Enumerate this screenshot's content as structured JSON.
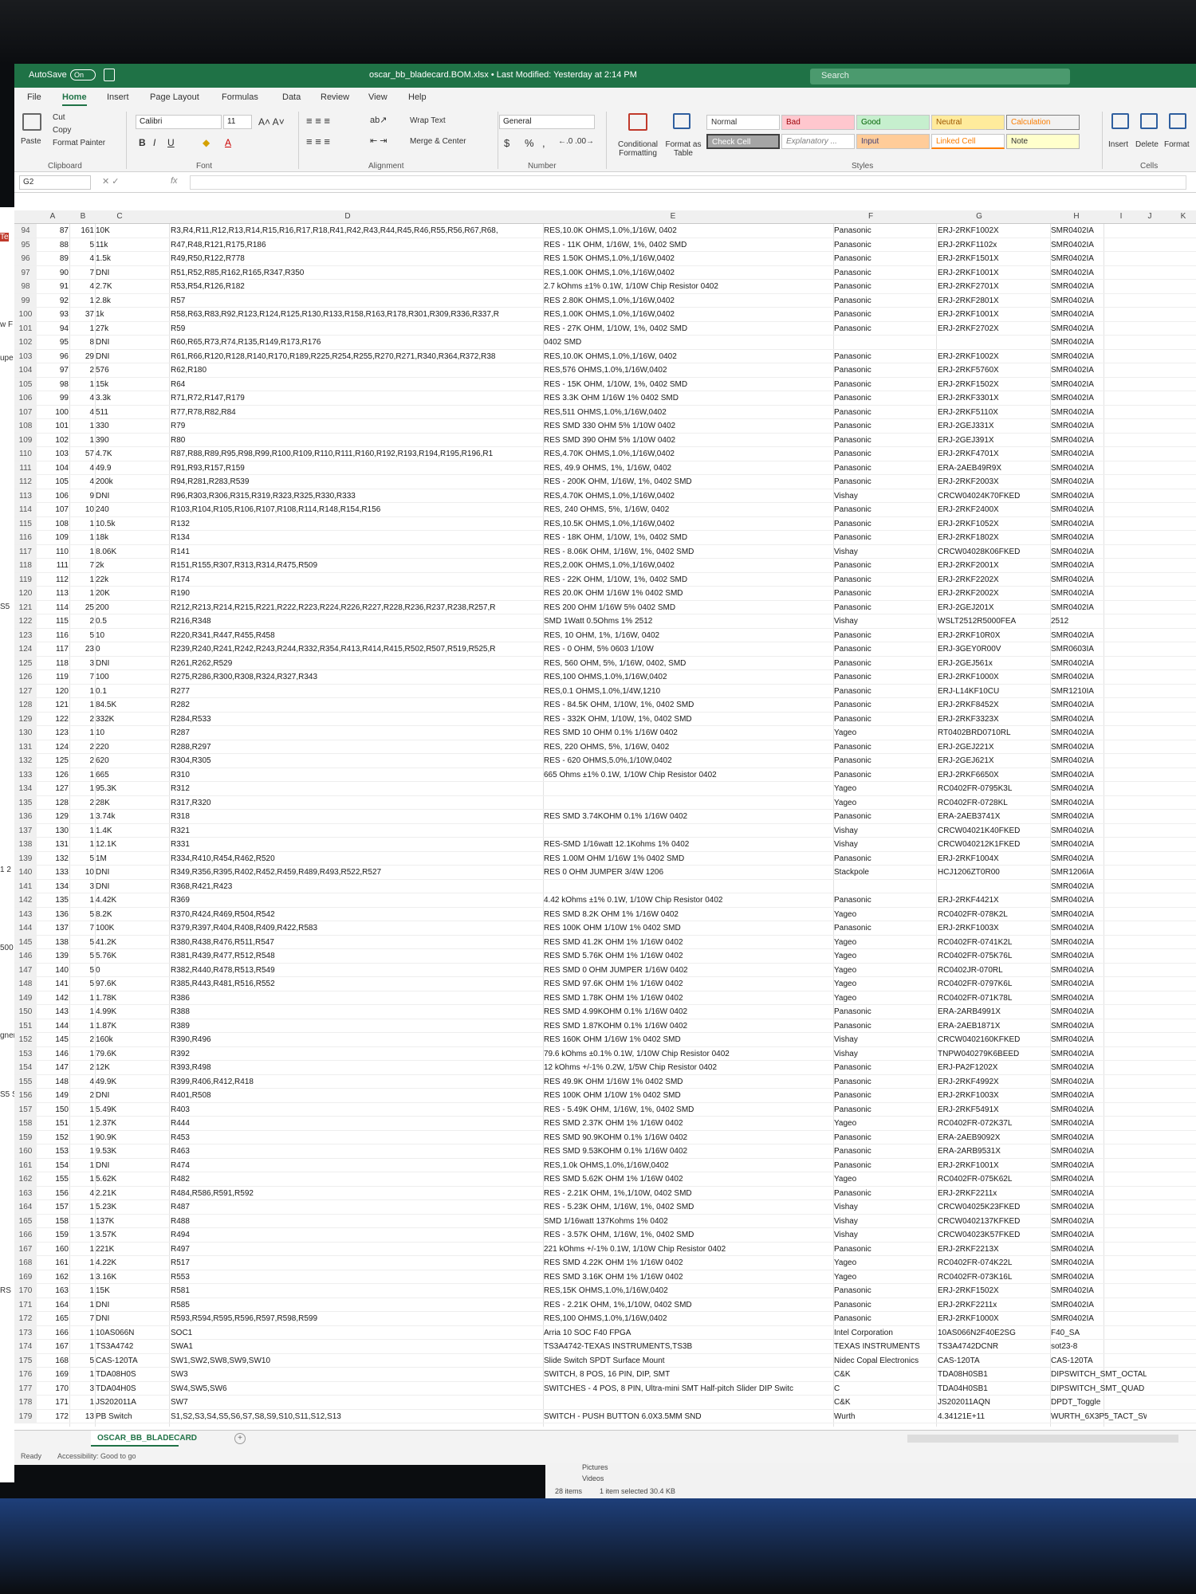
{
  "app": {
    "autosave_label": "AutoSave",
    "autosave_state": "On",
    "file_title": "oscar_bb_bladecard.BOM.xlsx • Last Modified: Yesterday at 2:14 PM",
    "search_placeholder": "Search"
  },
  "tabs": [
    "File",
    "Home",
    "Insert",
    "Page Layout",
    "Formulas",
    "Data",
    "Review",
    "View",
    "Help"
  ],
  "ribbon": {
    "clipboard": {
      "label": "Clipboard",
      "paste": "Paste",
      "cut": "Cut",
      "copy": "Copy",
      "format_painter": "Format Painter"
    },
    "font": {
      "label": "Font",
      "name": "Calibri",
      "size": "11"
    },
    "alignment": {
      "label": "Alignment",
      "wrap": "Wrap Text",
      "merge": "Merge & Center"
    },
    "number": {
      "label": "Number",
      "format": "General",
      "currency": "$",
      "percent": "%",
      "comma": ","
    },
    "styles": {
      "label": "Styles",
      "conditional": "Conditional Formatting",
      "format_table": "Format as Table",
      "items": [
        [
          "Normal",
          "Bad",
          "Good",
          "Neutral",
          "Calculation"
        ],
        [
          "Check Cell",
          "Explanatory ...",
          "Input",
          "Linked Cell",
          "Note"
        ]
      ]
    },
    "cells": {
      "label": "Cells",
      "insert": "Insert",
      "delete": "Delete",
      "format": "Format"
    }
  },
  "name_box": "G2",
  "fx": "fx",
  "columns": [
    "A",
    "B",
    "C",
    "D",
    "E",
    "F",
    "G",
    "H",
    "I",
    "J",
    "K"
  ],
  "rows": [
    [
      "94",
      "87",
      "161",
      "10K",
      "R3,R4,R11,R12,R13,R14,R15,R16,R17,R18,R41,R42,R43,R44,R45,R46,R55,R56,R67,R68,",
      "RES,10.0K OHMS,1.0%,1/16W, 0402",
      "Panasonic",
      "ERJ-2RKF1002X",
      "SMR0402IA"
    ],
    [
      "95",
      "88",
      "5",
      "11k",
      "R47,R48,R121,R175,R186",
      "RES - 11K OHM, 1/16W, 1%, 0402 SMD",
      "Panasonic",
      "ERJ-2RKF1102x",
      "SMR0402IA"
    ],
    [
      "96",
      "89",
      "4",
      "1.5k",
      "R49,R50,R122,R778",
      "RES 1.50K OHMS,1.0%,1/16W,0402",
      "Panasonic",
      "ERJ-2RKF1501X",
      "SMR0402IA"
    ],
    [
      "97",
      "90",
      "7",
      "DNI",
      "R51,R52,R85,R162,R165,R347,R350",
      "RES,1.00K OHMS,1.0%,1/16W,0402",
      "Panasonic",
      "ERJ-2RKF1001X",
      "SMR0402IA"
    ],
    [
      "98",
      "91",
      "4",
      "2.7K",
      "R53,R54,R126,R182",
      "2.7 kOhms ±1% 0.1W, 1/10W Chip Resistor 0402",
      "Panasonic",
      "ERJ-2RKF2701X",
      "SMR0402IA"
    ],
    [
      "99",
      "92",
      "1",
      "2.8k",
      "R57",
      "RES 2.80K OHMS,1.0%,1/16W,0402",
      "Panasonic",
      "ERJ-2RKF2801X",
      "SMR0402IA"
    ],
    [
      "100",
      "93",
      "37",
      "1k",
      "R58,R63,R83,R92,R123,R124,R125,R130,R133,R158,R163,R178,R301,R309,R336,R337,R",
      "RES,1.00K OHMS,1.0%,1/16W,0402",
      "Panasonic",
      "ERJ-2RKF1001X",
      "SMR0402IA"
    ],
    [
      "101",
      "94",
      "1",
      "27k",
      "R59",
      "RES - 27K OHM, 1/10W, 1%, 0402 SMD",
      "Panasonic",
      "ERJ-2RKF2702X",
      "SMR0402IA"
    ],
    [
      "102",
      "95",
      "8",
      "DNI",
      "R60,R65,R73,R74,R135,R149,R173,R176",
      "0402 SMD",
      "",
      "",
      "SMR0402IA"
    ],
    [
      "103",
      "96",
      "29",
      "DNI",
      "R61,R66,R120,R128,R140,R170,R189,R225,R254,R255,R270,R271,R340,R364,R372,R38",
      "RES,10.0K OHMS,1.0%,1/16W, 0402",
      "Panasonic",
      "ERJ-2RKF1002X",
      "SMR0402IA"
    ],
    [
      "104",
      "97",
      "2",
      "576",
      "R62,R180",
      "RES,576 OHMS,1.0%,1/16W,0402",
      "Panasonic",
      "ERJ-2RKF5760X",
      "SMR0402IA"
    ],
    [
      "105",
      "98",
      "1",
      "15k",
      "R64",
      "RES - 15K OHM, 1/10W, 1%, 0402 SMD",
      "Panasonic",
      "ERJ-2RKF1502X",
      "SMR0402IA"
    ],
    [
      "106",
      "99",
      "4",
      "3.3k",
      "R71,R72,R147,R179",
      "RES 3.3K OHM 1/16W 1% 0402 SMD",
      "Panasonic",
      "ERJ-2RKF3301X",
      "SMR0402IA"
    ],
    [
      "107",
      "100",
      "4",
      "511",
      "R77,R78,R82,R84",
      "RES,511 OHMS,1.0%,1/16W,0402",
      "Panasonic",
      "ERJ-2RKF5110X",
      "SMR0402IA"
    ],
    [
      "108",
      "101",
      "1",
      "330",
      "R79",
      "RES SMD 330 OHM 5% 1/10W 0402",
      "Panasonic",
      "ERJ-2GEJ331X",
      "SMR0402IA"
    ],
    [
      "109",
      "102",
      "1",
      "390",
      "R80",
      "RES SMD 390 OHM 5% 1/10W 0402",
      "Panasonic",
      "ERJ-2GEJ391X",
      "SMR0402IA"
    ],
    [
      "110",
      "103",
      "57",
      "4.7K",
      "R87,R88,R89,R95,R98,R99,R100,R109,R110,R111,R160,R192,R193,R194,R195,R196,R1",
      "RES,4.70K OHMS,1.0%,1/16W,0402",
      "Panasonic",
      "ERJ-2RKF4701X",
      "SMR0402IA"
    ],
    [
      "111",
      "104",
      "4",
      "49.9",
      "R91,R93,R157,R159",
      "RES, 49.9 OHMS, 1%, 1/16W, 0402",
      "Panasonic",
      "ERA-2AEB49R9X",
      "SMR0402IA"
    ],
    [
      "112",
      "105",
      "4",
      "200k",
      "R94,R281,R283,R539",
      "RES - 200K OHM, 1/16W, 1%, 0402 SMD",
      "Panasonic",
      "ERJ-2RKF2003X",
      "SMR0402IA"
    ],
    [
      "113",
      "106",
      "9",
      "DNI",
      "R96,R303,R306,R315,R319,R323,R325,R330,R333",
      "RES,4.70K OHMS,1.0%,1/16W,0402",
      "Vishay",
      "CRCW04024K70FKED",
      "SMR0402IA"
    ],
    [
      "114",
      "107",
      "10",
      "240",
      "R103,R104,R105,R106,R107,R108,R114,R148,R154,R156",
      "RES, 240 OHMS, 5%, 1/16W, 0402",
      "Panasonic",
      "ERJ-2RKF2400X",
      "SMR0402IA"
    ],
    [
      "115",
      "108",
      "1",
      "10.5k",
      "R132",
      "RES,10.5K OHMS,1.0%,1/16W,0402",
      "Panasonic",
      "ERJ-2RKF1052X",
      "SMR0402IA"
    ],
    [
      "116",
      "109",
      "1",
      "18k",
      "R134",
      "RES - 18K OHM, 1/10W, 1%, 0402 SMD",
      "Panasonic",
      "ERJ-2RKF1802X",
      "SMR0402IA"
    ],
    [
      "117",
      "110",
      "1",
      "8.06K",
      "R141",
      "RES - 8.06K OHM, 1/16W, 1%, 0402 SMD",
      "Vishay",
      "CRCW04028K06FKED",
      "SMR0402IA"
    ],
    [
      "118",
      "111",
      "7",
      "2k",
      "R151,R155,R307,R313,R314,R475,R509",
      "RES,2.00K OHMS,1.0%,1/16W,0402",
      "Panasonic",
      "ERJ-2RKF2001X",
      "SMR0402IA"
    ],
    [
      "119",
      "112",
      "1",
      "22k",
      "R174",
      "RES - 22K OHM, 1/10W, 1%, 0402 SMD",
      "Panasonic",
      "ERJ-2RKF2202X",
      "SMR0402IA"
    ],
    [
      "120",
      "113",
      "1",
      "20K",
      "R190",
      "RES 20.0K OHM 1/16W 1% 0402 SMD",
      "Panasonic",
      "ERJ-2RKF2002X",
      "SMR0402IA"
    ],
    [
      "121",
      "114",
      "25",
      "200",
      "R212,R213,R214,R215,R221,R222,R223,R224,R226,R227,R228,R236,R237,R238,R257,R",
      "RES 200 OHM 1/16W 5% 0402 SMD",
      "Panasonic",
      "ERJ-2GEJ201X",
      "SMR0402IA"
    ],
    [
      "122",
      "115",
      "2",
      "0.5",
      "R216,R348",
      "SMD 1Watt 0.5Ohms 1% 2512",
      "Vishay",
      "WSLT2512R5000FEA",
      "2512"
    ],
    [
      "123",
      "116",
      "5",
      "10",
      "R220,R341,R447,R455,R458",
      "RES, 10 OHM, 1%, 1/16W, 0402",
      "Panasonic",
      "ERJ-2RKF10R0X",
      "SMR0402IA"
    ],
    [
      "124",
      "117",
      "23",
      "0",
      "R239,R240,R241,R242,R243,R244,R332,R354,R413,R414,R415,R502,R507,R519,R525,R",
      "RES - 0 OHM, 5% 0603 1/10W",
      "Panasonic",
      "ERJ-3GEY0R00V",
      "SMR0603IA"
    ],
    [
      "125",
      "118",
      "3",
      "DNI",
      "R261,R262,R529",
      "RES, 560 OHM, 5%, 1/16W, 0402, SMD",
      "Panasonic",
      "ERJ-2GEJ561x",
      "SMR0402IA"
    ],
    [
      "126",
      "119",
      "7",
      "100",
      "R275,R286,R300,R308,R324,R327,R343",
      "RES,100 OHMS,1.0%,1/16W,0402",
      "Panasonic",
      "ERJ-2RKF1000X",
      "SMR0402IA"
    ],
    [
      "127",
      "120",
      "1",
      "0.1",
      "R277",
      "RES,0.1 OHMS,1.0%,1/4W,1210",
      "Panasonic",
      "ERJ-L14KF10CU",
      "SMR1210IA"
    ],
    [
      "128",
      "121",
      "1",
      "84.5K",
      "R282",
      "RES - 84.5K OHM, 1/10W, 1%, 0402 SMD",
      "Panasonic",
      "ERJ-2RKF8452X",
      "SMR0402IA"
    ],
    [
      "129",
      "122",
      "2",
      "332K",
      "R284,R533",
      "RES - 332K OHM, 1/10W, 1%, 0402 SMD",
      "Panasonic",
      "ERJ-2RKF3323X",
      "SMR0402IA"
    ],
    [
      "130",
      "123",
      "1",
      "10",
      "R287",
      "RES SMD 10 OHM 0.1% 1/16W 0402",
      "Yageo",
      "RT0402BRD0710RL",
      "SMR0402IA"
    ],
    [
      "131",
      "124",
      "2",
      "220",
      "R288,R297",
      "RES, 220 OHMS, 5%, 1/16W, 0402",
      "Panasonic",
      "ERJ-2GEJ221X",
      "SMR0402IA"
    ],
    [
      "132",
      "125",
      "2",
      "620",
      "R304,R305",
      "RES - 620 OHMS,5.0%,1/10W,0402",
      "Panasonic",
      "ERJ-2GEJ621X",
      "SMR0402IA"
    ],
    [
      "133",
      "126",
      "1",
      "665",
      "R310",
      "665 Ohms ±1% 0.1W, 1/10W Chip Resistor 0402",
      "Panasonic",
      "ERJ-2RKF6650X",
      "SMR0402IA"
    ],
    [
      "134",
      "127",
      "1",
      "95.3K",
      "R312",
      "",
      "Yageo",
      "RC0402FR-0795K3L",
      "SMR0402IA"
    ],
    [
      "135",
      "128",
      "2",
      "28K",
      "R317,R320",
      "",
      "Yageo",
      "RC0402FR-0728KL",
      "SMR0402IA"
    ],
    [
      "136",
      "129",
      "1",
      "3.74k",
      "R318",
      "RES SMD 3.74KOHM 0.1% 1/16W 0402",
      "Panasonic",
      "ERA-2AEB3741X",
      "SMR0402IA"
    ],
    [
      "137",
      "130",
      "1",
      "1.4K",
      "R321",
      "",
      "Vishay",
      "CRCW04021K40FKED",
      "SMR0402IA"
    ],
    [
      "138",
      "131",
      "1",
      "12.1K",
      "R331",
      "RES-SMD 1/16watt 12.1Kohms 1% 0402",
      "Vishay",
      "CRCW040212K1FKED",
      "SMR0402IA"
    ],
    [
      "139",
      "132",
      "5",
      "1M",
      "R334,R410,R454,R462,R520",
      "RES 1.00M OHM 1/16W 1% 0402 SMD",
      "Panasonic",
      "ERJ-2RKF1004X",
      "SMR0402IA"
    ],
    [
      "140",
      "133",
      "10",
      "DNI",
      "R349,R356,R395,R402,R452,R459,R489,R493,R522,R527",
      "RES 0 OHM JUMPER 3/4W 1206",
      "Stackpole",
      "HCJ1206ZT0R00",
      "SMR1206IA"
    ],
    [
      "141",
      "134",
      "3",
      "DNI",
      "R368,R421,R423",
      "",
      "",
      "",
      "SMR0402IA"
    ],
    [
      "142",
      "135",
      "1",
      "4.42K",
      "R369",
      "4.42 kOhms ±1% 0.1W, 1/10W Chip Resistor 0402",
      "Panasonic",
      "ERJ-2RKF4421X",
      "SMR0402IA"
    ],
    [
      "143",
      "136",
      "5",
      "8.2K",
      "R370,R424,R469,R504,R542",
      "RES SMD 8.2K OHM 1% 1/16W 0402",
      "Yageo",
      "RC0402FR-078K2L",
      "SMR0402IA"
    ],
    [
      "144",
      "137",
      "7",
      "100K",
      "R379,R397,R404,R408,R409,R422,R583",
      "RES 100K OHM 1/10W 1% 0402 SMD",
      "Panasonic",
      "ERJ-2RKF1003X",
      "SMR0402IA"
    ],
    [
      "145",
      "138",
      "5",
      "41.2K",
      "R380,R438,R476,R511,R547",
      "RES SMD 41.2K OHM 1% 1/16W 0402",
      "Yageo",
      "RC0402FR-0741K2L",
      "SMR0402IA"
    ],
    [
      "146",
      "139",
      "5",
      "5.76K",
      "R381,R439,R477,R512,R548",
      "RES SMD 5.76K OHM 1% 1/16W 0402",
      "Yageo",
      "RC0402FR-075K76L",
      "SMR0402IA"
    ],
    [
      "147",
      "140",
      "5",
      "0",
      "R382,R440,R478,R513,R549",
      "RES SMD 0 OHM JUMPER 1/16W 0402",
      "Yageo",
      "RC0402JR-070RL",
      "SMR0402IA"
    ],
    [
      "148",
      "141",
      "5",
      "97.6K",
      "R385,R443,R481,R516,R552",
      "RES SMD 97.6K OHM 1% 1/16W 0402",
      "Yageo",
      "RC0402FR-0797K6L",
      "SMR0402IA"
    ],
    [
      "149",
      "142",
      "1",
      "1.78K",
      "R386",
      "RES SMD 1.78K OHM 1% 1/16W 0402",
      "Yageo",
      "RC0402FR-071K78L",
      "SMR0402IA"
    ],
    [
      "150",
      "143",
      "1",
      "4.99K",
      "R388",
      "RES SMD 4.99KOHM 0.1% 1/16W 0402",
      "Panasonic",
      "ERA-2ARB4991X",
      "SMR0402IA"
    ],
    [
      "151",
      "144",
      "1",
      "1.87K",
      "R389",
      "RES SMD 1.87KOHM 0.1% 1/16W 0402",
      "Panasonic",
      "ERA-2AEB1871X",
      "SMR0402IA"
    ],
    [
      "152",
      "145",
      "2",
      "160k",
      "R390,R496",
      "RES 160K OHM 1/16W 1% 0402 SMD",
      "Vishay",
      "CRCW0402160KFKED",
      "SMR0402IA"
    ],
    [
      "153",
      "146",
      "1",
      "79.6K",
      "R392",
      "79.6 kOhms ±0.1% 0.1W, 1/10W Chip Resistor 0402",
      "Vishay",
      "TNPW040279K6BEED",
      "SMR0402IA"
    ],
    [
      "154",
      "147",
      "2",
      "12K",
      "R393,R498",
      "12 kOhms +/-1% 0.2W, 1/5W Chip Resistor 0402",
      "Panasonic",
      "ERJ-PA2F1202X",
      "SMR0402IA"
    ],
    [
      "155",
      "148",
      "4",
      "49.9K",
      "R399,R406,R412,R418",
      "RES 49.9K OHM 1/16W 1% 0402 SMD",
      "Panasonic",
      "ERJ-2RKF4992X",
      "SMR0402IA"
    ],
    [
      "156",
      "149",
      "2",
      "DNI",
      "R401,R508",
      "RES 100K OHM 1/10W 1% 0402 SMD",
      "Panasonic",
      "ERJ-2RKF1003X",
      "SMR0402IA"
    ],
    [
      "157",
      "150",
      "1",
      "5.49K",
      "R403",
      "RES - 5.49K OHM, 1/16W, 1%, 0402 SMD",
      "Panasonic",
      "ERJ-2RKF5491X",
      "SMR0402IA"
    ],
    [
      "158",
      "151",
      "1",
      "2.37K",
      "R444",
      "RES SMD 2.37K OHM 1% 1/16W 0402",
      "Yageo",
      "RC0402FR-072K37L",
      "SMR0402IA"
    ],
    [
      "159",
      "152",
      "1",
      "90.9K",
      "R453",
      "RES SMD 90.9KOHM 0.1% 1/16W 0402",
      "Panasonic",
      "ERA-2AEB9092X",
      "SMR0402IA"
    ],
    [
      "160",
      "153",
      "1",
      "9.53K",
      "R463",
      "RES SMD 9.53KOHM 0.1% 1/16W 0402",
      "Panasonic",
      "ERA-2ARB9531X",
      "SMR0402IA"
    ],
    [
      "161",
      "154",
      "1",
      "DNI",
      "R474",
      "RES,1.0k OHMS,1.0%,1/16W,0402",
      "Panasonic",
      "ERJ-2RKF1001X",
      "SMR0402IA"
    ],
    [
      "162",
      "155",
      "1",
      "5.62K",
      "R482",
      "RES SMD 5.62K OHM 1% 1/16W 0402",
      "Yageo",
      "RC0402FR-075K62L",
      "SMR0402IA"
    ],
    [
      "163",
      "156",
      "4",
      "2.21K",
      "R484,R586,R591,R592",
      "RES - 2.21K OHM, 1%,1/10W, 0402 SMD",
      "Panasonic",
      "ERJ-2RKF2211x",
      "SMR0402IA"
    ],
    [
      "164",
      "157",
      "1",
      "5.23K",
      "R487",
      "RES - 5.23K OHM, 1/16W, 1%, 0402 SMD",
      "Vishay",
      "CRCW04025K23FKED",
      "SMR0402IA"
    ],
    [
      "165",
      "158",
      "1",
      "137K",
      "R488",
      "SMD 1/16watt 137Kohms 1% 0402",
      "Vishay",
      "CRCW0402137KFKED",
      "SMR0402IA"
    ],
    [
      "166",
      "159",
      "1",
      "3.57K",
      "R494",
      "RES - 3.57K OHM, 1/16W, 1%, 0402 SMD",
      "Vishay",
      "CRCW04023K57FKED",
      "SMR0402IA"
    ],
    [
      "167",
      "160",
      "1",
      "221K",
      "R497",
      "221 kOhms +/-1% 0.1W, 1/10W Chip Resistor 0402",
      "Panasonic",
      "ERJ-2RKF2213X",
      "SMR0402IA"
    ],
    [
      "168",
      "161",
      "1",
      "4.22K",
      "R517",
      "RES SMD 4.22K OHM 1% 1/16W 0402",
      "Yageo",
      "RC0402FR-074K22L",
      "SMR0402IA"
    ],
    [
      "169",
      "162",
      "1",
      "3.16K",
      "R553",
      "RES SMD 3.16K OHM 1% 1/16W 0402",
      "Yageo",
      "RC0402FR-073K16L",
      "SMR0402IA"
    ],
    [
      "170",
      "163",
      "1",
      "15K",
      "R581",
      "RES,15K OHMS,1.0%,1/16W,0402",
      "Panasonic",
      "ERJ-2RKF1502X",
      "SMR0402IA"
    ],
    [
      "171",
      "164",
      "1",
      "DNI",
      "R585",
      "RES - 2.21K OHM, 1%,1/10W, 0402 SMD",
      "Panasonic",
      "ERJ-2RKF2211x",
      "SMR0402IA"
    ],
    [
      "172",
      "165",
      "7",
      "DNI",
      "R593,R594,R595,R596,R597,R598,R599",
      "RES,100 OHMS,1.0%,1/16W,0402",
      "Panasonic",
      "ERJ-2RKF1000X",
      "SMR0402IA"
    ],
    [
      "173",
      "166",
      "1",
      "10AS066N",
      "SOC1",
      "Arria 10 SOC F40 FPGA",
      "Intel Corporation",
      "10AS066N2F40E2SG",
      "F40_SA"
    ],
    [
      "174",
      "167",
      "1",
      "TS3A4742",
      "SWA1",
      "TS3A4742-TEXAS INSTRUMENTS,TS3B",
      "TEXAS INSTRUMENTS",
      "TS3A4742DCNR",
      "sot23-8"
    ],
    [
      "175",
      "168",
      "5",
      "CAS-120TA",
      "SW1,SW2,SW8,SW9,SW10",
      "Slide Switch SPDT Surface Mount",
      "Nidec Copal Electronics",
      "CAS-120TA",
      "CAS-120TA"
    ],
    [
      "176",
      "169",
      "1",
      "TDA08H0S",
      "SW3",
      "SWITCH, 8 POS, 16 PIN, DIP, SMT",
      "C&K",
      "TDA08H0SB1",
      "DIPSWITCH_SMT_OCTAL"
    ],
    [
      "177",
      "170",
      "3",
      "TDA04H0S",
      "SW4,SW5,SW6",
      "SWITCHES - 4 POS, 8 PIN, Ultra-mini SMT Half-pitch Slider DIP Switc",
      "C",
      "TDA04H0SB1",
      "DIPSWITCH_SMT_QUAD"
    ],
    [
      "178",
      "171",
      "1",
      "JS202011A",
      "SW7",
      "",
      "C&K",
      "JS202011AQN",
      "DPDT_Toggle"
    ],
    [
      "179",
      "172",
      "13",
      "PB Switch",
      "S1,S2,S3,S4,S5,S6,S7,S8,S9,S10,S11,S12,S13",
      "SWITCH - PUSH BUTTON 6.0X3.5MM SND",
      "Wurth",
      "4.34121E+11",
      "WURTH_6X3P5_TACT_SWITCH"
    ]
  ],
  "sheet_tab": "OSCAR_BB_BLADECARD",
  "status": {
    "ready": "Ready",
    "accessibility": "Accessibility: Good to go"
  },
  "explorer": {
    "folder1": "Pictures",
    "folder2": "Videos",
    "items": "28 items",
    "selected": "1 item selected  30.4 KB"
  },
  "left_strip": [
    "Te",
    "w F",
    "upe",
    "S5",
    "1 2",
    "500",
    "gner",
    "S5 S",
    "RS"
  ]
}
